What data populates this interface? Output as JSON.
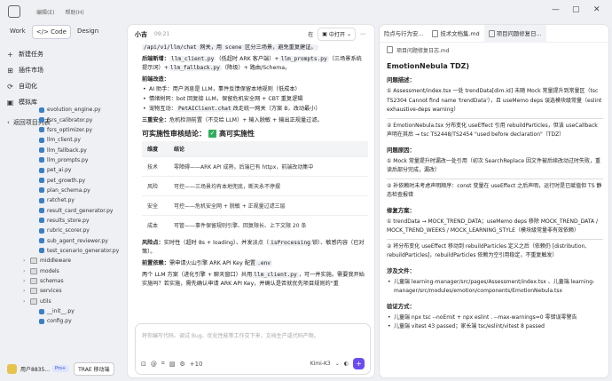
{
  "titlebar": {
    "menu": [
      "编辑(E)",
      "帮助(H)"
    ],
    "controls": [
      "—",
      "▢",
      "✕"
    ]
  },
  "sidebar": {
    "modes": [
      "Work",
      "Code",
      "Design"
    ],
    "nav": [
      {
        "icon": "+",
        "label": "新建任务"
      },
      {
        "icon": "⊞",
        "label": "插件市场"
      },
      {
        "icon": "⟳",
        "label": "自动化"
      },
      {
        "icon": "▣",
        "label": "模拟库"
      }
    ],
    "recent_label": "返回项目列表",
    "files": [
      "evolution_engine.py",
      "fsrs_calibrator.py",
      "fsrs_optimizer.py",
      "llm_client.py",
      "llm_fallback.py",
      "llm_prompts.py",
      "pet_ai.py",
      "pet_growth.py",
      "plan_schema.py",
      "ratchet.py",
      "result_card_generator.py",
      "results_store.py",
      "rubric_scorer.py",
      "sub_agent_reviewer.py",
      "test_scenario_generator.py"
    ],
    "folders": [
      "middleware",
      "models",
      "schemas",
      "services",
      "utils"
    ],
    "tail": [
      "__init__.py",
      "config.py"
    ],
    "user": "用户8835...",
    "pro": "Pro+",
    "trae": "TRAE 移动端"
  },
  "chat": {
    "title": "小吉",
    "time": "09:21",
    "where": "在",
    "open_label": "中打开",
    "lines": {
      "l1a": "/api/v1/llm/chat 网关，用 scene 区分三场景，避免重复建证。",
      "l2a": "后端新增：",
      "l2b": "llm_client.py",
      "l2c": "（低超时 ARK 客户端）+",
      "l2d": "llm_prompts.py",
      "l2e": "（三场景系统提示词）+",
      "l2f": "llm_fallback.py",
      "l2g": "（降级）+ 路由/Schema。",
      "l3": "前端改造：",
      "b1": "AI 助手：用户消息是 LLM，事件反馈保留本地规则（低成本）",
      "b2": "情绪树同：bot 回复接 LLM，保留危机安全网 + CBT 重复逻辑",
      "b3a": "宠物互动：",
      "b3b": "PetAIClient.chat",
      "b3c": "改走统一网关（方案 B，改动最小）",
      "l4a": "三重安全：",
      "l4b": "危机检测前置（不交给 LLM）+ 输入脱敏 + 输出正规量过滤。",
      "h3": "可实施性审核结论：",
      "h3b": "高可实施性"
    },
    "table": {
      "headers": [
        "维度",
        "结论"
      ],
      "rows": [
        [
          "技术",
          "零障碍——ARK API 成熟，后端已有 httpx，前端改动集中"
        ],
        [
          "风险",
          "可控——三场景均有本地兜底，断天永不停摆"
        ],
        [
          "安全",
          "可控——危机安全网 + 脱敏 + 正规量过滤三层"
        ],
        [
          "成本",
          "可管——事件保留规则引擎、回复限长、上下文限 20 条"
        ]
      ]
    },
    "after": {
      "a1a": "风险点：",
      "a1b": "实时性（超时 8s + loading）、并发淡点（",
      "a1c": "isProcessing",
      "a1d": "锁）、敏感内容（已对策）。",
      "a2a": "前置依赖：",
      "a2b": "需申请火山引擎 ARK API Key 配置",
      "a2c": ".env",
      "a3": "两个 LLM 方案（进化引擎 + 聊天窗口）共用",
      "a3b": "llm_client.py",
      "a3c": "，可一并实施。需要我开始实施吗？若实施，需先确认申请 ARK API Key，并确认是否就优先项目规则的\"重"
    },
    "composer_placeholder": "将你编写代码、调试 Bug、优化性能等工作交下来，文档生产或代码产物。",
    "composer_count": "+10",
    "model": "Kimi-K3"
  },
  "doc": {
    "tabs": [
      "险点与行为安...",
      "技术文档集.md",
      "项目问题修复日..."
    ],
    "breadcrumb": "项目问题修复日志.md",
    "heading": "EmotionNebula TDZ)",
    "sections": {
      "s1": "问题描述：",
      "s1i1": "① Assessment/index.tsx 一处 trendData[dim.id] 未随 Mock 常量提升到常量区（tsc TS2304 Cannot find name 'trendData'），且 useMemo deps 误选模块级常量（eslint exhaustive-deps warning）",
      "s1i2": "② EmotionNebula.tsx 分布变化 useEffect 引用 rebuildParticles，但该 useCallback 声明在其后 → tsc TS2448/TS2454 \"used before declaration\"（TDZ）",
      "s2": "问题原因：",
      "s2i1": "① Mock 常量提升时漏改一处引用（初次 SearchReplace 因文件被后续改动过时失败，重读后部分完成，漏改）",
      "s2i2": "② 补依赖时未考虑声明顺序：const 变量在 useEffect 之后声明，运行时是已赋值但 TS 静态检查报错",
      "s3": "修复方案：",
      "s3i1": "① trendData → MOCK_TREND_DATA；useMemo deps 移除 MOCK_TREND_DATA / MOCK_TREND_WEEKS / MOCK_LEARNING_STYLE（模块级常量非有效依赖）",
      "s3i2": "② 将分布变化 useEffect 移动到 rebuildParticles 定义之后（依赖仍 [distribution, rebuildParticles]，rebuildParticles 依赖为空引用稳定，不重复触发）",
      "s4": "涉及文件：",
      "s4i1": "儿童端 learning-manager/src/pages/Assessment/index.tsx 、儿童端 learning-manager/src/modules/emotion/components/EmotionNebula.tsx",
      "s5": "验证方式：",
      "s5i1": "儿童端 npx tsc --noEmit + npx eslint . --max-warnings=0 零错误零警告",
      "s5i2": "儿童端 vitest 43 passed；家长端 tsc/eslint/vitest 8 passed"
    }
  }
}
